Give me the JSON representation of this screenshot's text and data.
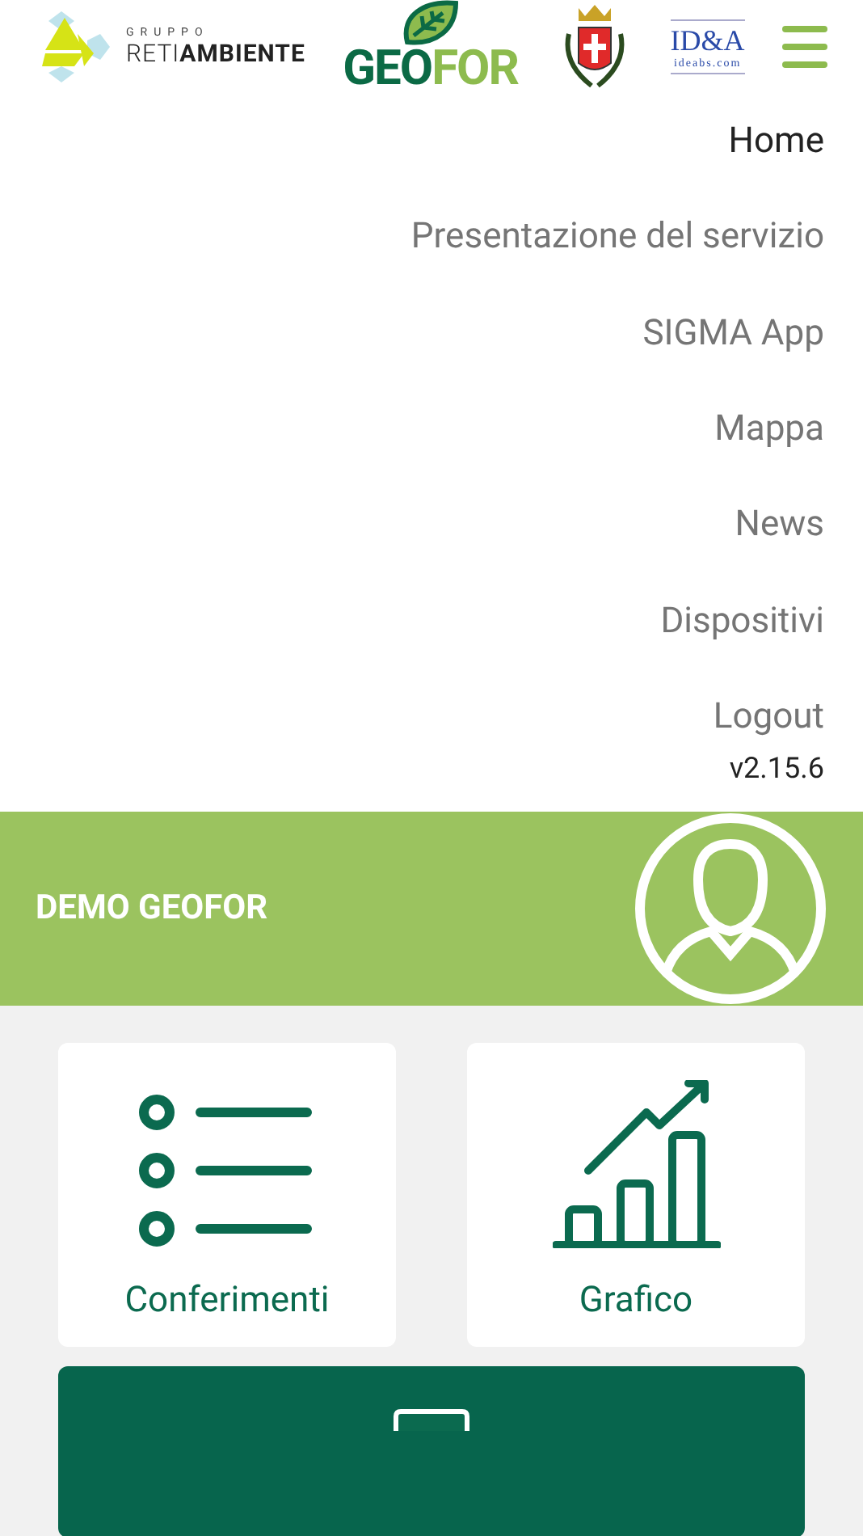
{
  "header": {
    "logos": {
      "group_caption": "GRUPPO",
      "group_name_light": "RETI",
      "group_name_bold": "AMBIENTE",
      "brand_dark": "GEO",
      "brand_light": "FOR",
      "partner_name": "ID&A",
      "partner_site": "ideabs.com"
    }
  },
  "menu": {
    "items": [
      {
        "label": "Home",
        "selected": true
      },
      {
        "label": "Presentazione del servizio",
        "selected": false
      },
      {
        "label": "SIGMA App",
        "selected": false
      },
      {
        "label": "Mappa",
        "selected": false
      },
      {
        "label": "News",
        "selected": false
      },
      {
        "label": "Dispositivi",
        "selected": false
      },
      {
        "label": "Logout",
        "selected": false
      }
    ],
    "version": "v2.15.6"
  },
  "profile": {
    "name": "DEMO GEOFOR"
  },
  "tiles": [
    {
      "kind": "list",
      "label": "Conferimenti"
    },
    {
      "kind": "chart",
      "label": "Grafico"
    }
  ]
}
